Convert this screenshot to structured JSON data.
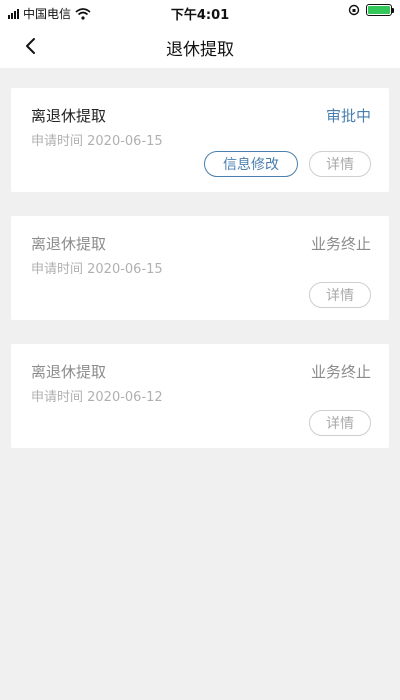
{
  "status_bar": {
    "carrier": "中国电信",
    "time": "下午4:01"
  },
  "nav": {
    "title": "退休提取"
  },
  "records": [
    {
      "title": "离退休提取",
      "date": "申请时间 2020-06-15",
      "status": "审批中",
      "edit_label": "信息修改",
      "detail_label": "详情"
    },
    {
      "title": "离退休提取",
      "date": "申请时间 2020-06-15",
      "status": "业务终止",
      "detail_label": "详情"
    },
    {
      "title": "离退休提取",
      "date": "申请时间 2020-06-12",
      "status": "业务终止",
      "detail_label": "详情"
    }
  ],
  "colors": {
    "accent": "#4a7fb0",
    "muted": "#8c8c8c",
    "background": "#f0f0f0"
  }
}
